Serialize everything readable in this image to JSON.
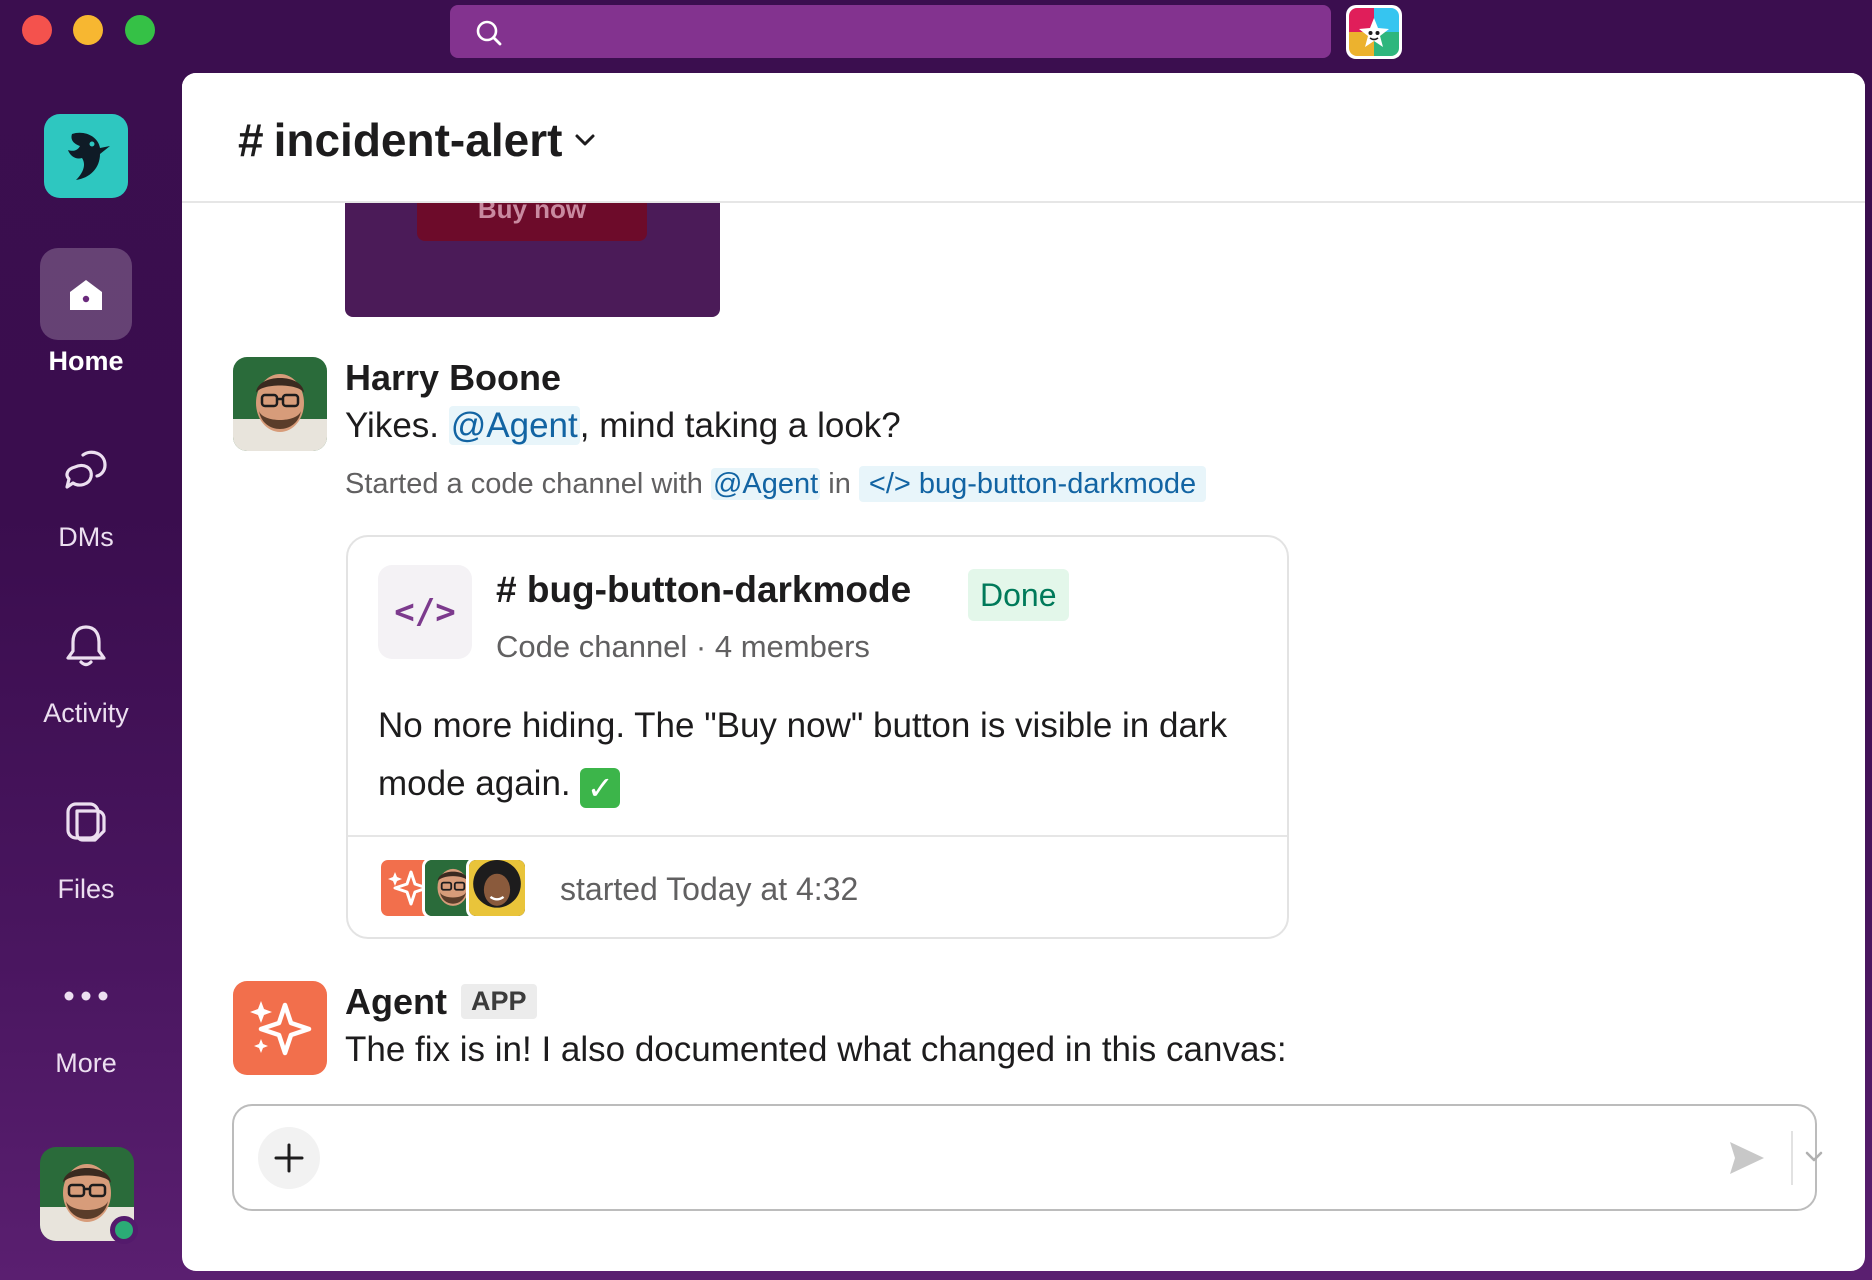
{
  "colors": {
    "sidebar_bg": "#3b0e4f",
    "search_bg": "#83338f",
    "workspace_logo": "#2ec7c0",
    "mention_text": "#1264a3",
    "done_badge_text": "#007a5a",
    "agent_orange": "#f26f4c",
    "presence_green": "#2bac76"
  },
  "titlebar": {
    "search_icon": "search-icon"
  },
  "sidebar": {
    "items": [
      {
        "label": "Home",
        "icon": "home-icon",
        "active": true
      },
      {
        "label": "DMs",
        "icon": "dms-icon"
      },
      {
        "label": "Activity",
        "icon": "bell-icon"
      },
      {
        "label": "Files",
        "icon": "files-icon"
      },
      {
        "label": "More",
        "icon": "more-icon"
      }
    ]
  },
  "channel": {
    "hash": "#",
    "name": "incident-alert"
  },
  "prev_message": {
    "button_label": "Buy now"
  },
  "messages": [
    {
      "sender": "Harry Boone",
      "text_before": "Yikes. ",
      "mention": "@Agent",
      "text_after": ", mind taking a look?",
      "meta_prefix": "Started a code channel with ",
      "meta_mention": "@Agent",
      "meta_in": " in ",
      "meta_channel": "</> bug-button-darkmode",
      "card": {
        "icon_glyph": "</>",
        "hash": "#",
        "title": "bug-button-darkmode",
        "status": "Done",
        "subtitle": "Code channel · 4 members",
        "body": "No more hiding. The \"Buy now\" button is visible in dark mode again.",
        "footer": "started Today at 4:32"
      }
    },
    {
      "sender": "Agent",
      "badge": "APP",
      "text": "The fix is in! I also documented what changed in this canvas:"
    }
  ],
  "composer": {
    "placeholder": ""
  }
}
